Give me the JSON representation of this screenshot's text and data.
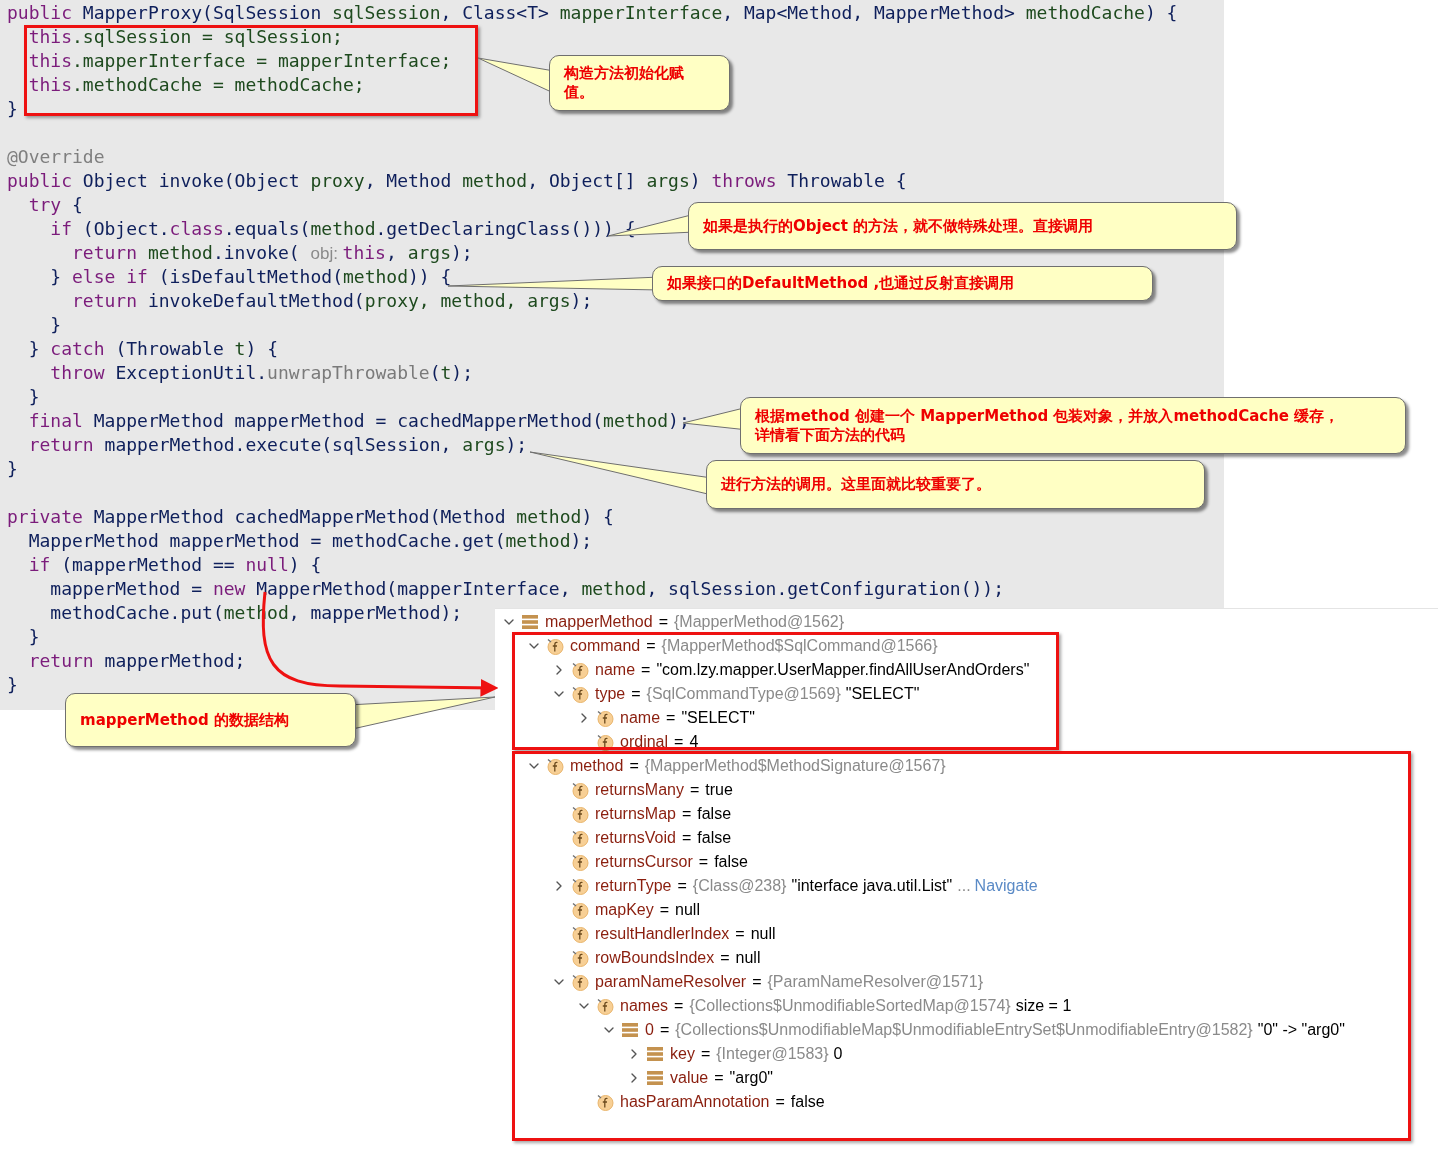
{
  "code": {
    "lines": [
      {
        "kind": "code",
        "segs": [
          {
            "kind": "keyword",
            "text": "public "
          },
          {
            "kind": "type",
            "text": "MapperProxy(SqlSession "
          },
          {
            "kind": "variable",
            "text": "sqlSession"
          },
          {
            "kind": "type",
            "text": ", Class<T> "
          },
          {
            "kind": "variable",
            "text": "mapperInterface"
          },
          {
            "kind": "type",
            "text": ", Map<Method, MapperMethod> "
          },
          {
            "kind": "variable",
            "text": "methodCache"
          },
          {
            "kind": "type",
            "text": ") {"
          }
        ]
      },
      {
        "kind": "code",
        "segs": [
          {
            "kind": "keyword",
            "text": "  this"
          },
          {
            "kind": "variable",
            "text": ".sqlSession = sqlSession;"
          }
        ]
      },
      {
        "kind": "code",
        "segs": [
          {
            "kind": "keyword",
            "text": "  this"
          },
          {
            "kind": "variable",
            "text": ".mapperInterface = mapperInterface;"
          }
        ]
      },
      {
        "kind": "code",
        "segs": [
          {
            "kind": "keyword",
            "text": "  this"
          },
          {
            "kind": "variable",
            "text": ".methodCache = methodCache;"
          }
        ]
      },
      {
        "kind": "code",
        "segs": [
          {
            "kind": "type",
            "text": "}"
          }
        ]
      },
      {
        "kind": "blank"
      },
      {
        "kind": "code",
        "segs": [
          {
            "kind": "annotation",
            "text": "@Override"
          }
        ]
      },
      {
        "kind": "code",
        "segs": [
          {
            "kind": "keyword",
            "text": "public "
          },
          {
            "kind": "type",
            "text": "Object invoke(Object "
          },
          {
            "kind": "variable",
            "text": "proxy"
          },
          {
            "kind": "type",
            "text": ", Method "
          },
          {
            "kind": "variable",
            "text": "method"
          },
          {
            "kind": "type",
            "text": ", Object[] "
          },
          {
            "kind": "variable",
            "text": "args"
          },
          {
            "kind": "type",
            "text": ") "
          },
          {
            "kind": "keyword",
            "text": "throws "
          },
          {
            "kind": "type",
            "text": "Throwable {"
          }
        ]
      },
      {
        "kind": "code",
        "segs": [
          {
            "kind": "keyword",
            "text": "  try "
          },
          {
            "kind": "type",
            "text": "{"
          }
        ]
      },
      {
        "kind": "code",
        "segs": [
          {
            "kind": "keyword",
            "text": "    if "
          },
          {
            "kind": "type",
            "text": "(Object."
          },
          {
            "kind": "keyword",
            "text": "class"
          },
          {
            "kind": "type",
            "text": ".equals("
          },
          {
            "kind": "variable",
            "text": "method"
          },
          {
            "kind": "type",
            "text": ".getDeclaringClass())) {"
          }
        ]
      },
      {
        "kind": "code",
        "segs": [
          {
            "kind": "keyword",
            "text": "      return "
          },
          {
            "kind": "variable",
            "text": "method"
          },
          {
            "kind": "type",
            "text": ".invoke( "
          },
          {
            "kind": "hint",
            "text": "obj: "
          },
          {
            "kind": "keyword",
            "text": "this"
          },
          {
            "kind": "type",
            "text": ", "
          },
          {
            "kind": "variable",
            "text": "args"
          },
          {
            "kind": "type",
            "text": ");"
          }
        ]
      },
      {
        "kind": "code",
        "segs": [
          {
            "kind": "type",
            "text": "    } "
          },
          {
            "kind": "keyword",
            "text": "else if "
          },
          {
            "kind": "type",
            "text": "(isDefaultMethod("
          },
          {
            "kind": "variable",
            "text": "method"
          },
          {
            "kind": "type",
            "text": ")) {"
          }
        ]
      },
      {
        "kind": "code",
        "segs": [
          {
            "kind": "keyword",
            "text": "      return "
          },
          {
            "kind": "type",
            "text": "invokeDefaultMethod("
          },
          {
            "kind": "variable",
            "text": "proxy, method, args"
          },
          {
            "kind": "type",
            "text": ");"
          }
        ]
      },
      {
        "kind": "code",
        "segs": [
          {
            "kind": "type",
            "text": "    }"
          }
        ]
      },
      {
        "kind": "code",
        "segs": [
          {
            "kind": "type",
            "text": "  } "
          },
          {
            "kind": "keyword",
            "text": "catch "
          },
          {
            "kind": "type",
            "text": "(Throwable "
          },
          {
            "kind": "variable",
            "text": "t"
          },
          {
            "kind": "type",
            "text": ") {"
          }
        ]
      },
      {
        "kind": "code",
        "segs": [
          {
            "kind": "keyword",
            "text": "    throw "
          },
          {
            "kind": "type",
            "text": "ExceptionUtil."
          },
          {
            "kind": "static",
            "text": "unwrapThrowable"
          },
          {
            "kind": "type",
            "text": "("
          },
          {
            "kind": "variable",
            "text": "t"
          },
          {
            "kind": "type",
            "text": ");"
          }
        ]
      },
      {
        "kind": "code",
        "segs": [
          {
            "kind": "type",
            "text": "  }"
          }
        ]
      },
      {
        "kind": "code",
        "segs": [
          {
            "kind": "keyword",
            "text": "  final "
          },
          {
            "kind": "type",
            "text": "MapperMethod mapperMethod = cachedMapperMethod("
          },
          {
            "kind": "variable",
            "text": "method"
          },
          {
            "kind": "type",
            "text": ");"
          }
        ]
      },
      {
        "kind": "code",
        "segs": [
          {
            "kind": "keyword",
            "text": "  return "
          },
          {
            "kind": "type",
            "text": "mapperMethod.execute(sqlSession, "
          },
          {
            "kind": "variable",
            "text": "args"
          },
          {
            "kind": "type",
            "text": ");"
          }
        ]
      },
      {
        "kind": "code",
        "segs": [
          {
            "kind": "type",
            "text": "}"
          }
        ]
      },
      {
        "kind": "blank"
      },
      {
        "kind": "code",
        "segs": [
          {
            "kind": "keyword",
            "text": "private "
          },
          {
            "kind": "type",
            "text": "MapperMethod cachedMapperMethod(Method "
          },
          {
            "kind": "variable",
            "text": "method"
          },
          {
            "kind": "type",
            "text": ") {"
          }
        ]
      },
      {
        "kind": "code",
        "segs": [
          {
            "kind": "type",
            "text": "  MapperMethod mapperMethod = methodCache.get("
          },
          {
            "kind": "variable",
            "text": "method"
          },
          {
            "kind": "type",
            "text": ");"
          }
        ]
      },
      {
        "kind": "code",
        "segs": [
          {
            "kind": "keyword",
            "text": "  if "
          },
          {
            "kind": "type",
            "text": "(mapperMethod == "
          },
          {
            "kind": "keyword",
            "text": "null"
          },
          {
            "kind": "type",
            "text": ") {"
          }
        ]
      },
      {
        "kind": "code",
        "segs": [
          {
            "kind": "type",
            "text": "    mapperMethod = "
          },
          {
            "kind": "keyword",
            "text": "new "
          },
          {
            "kind": "type",
            "text": "MapperMethod(mapperInterface, "
          },
          {
            "kind": "variable",
            "text": "method"
          },
          {
            "kind": "type",
            "text": ", sqlSession.getConfiguration());"
          }
        ]
      },
      {
        "kind": "code",
        "segs": [
          {
            "kind": "type",
            "text": "    methodCache.put("
          },
          {
            "kind": "variable",
            "text": "method"
          },
          {
            "kind": "type",
            "text": ", mapperMethod);"
          }
        ]
      },
      {
        "kind": "code",
        "segs": [
          {
            "kind": "type",
            "text": "  }"
          }
        ]
      },
      {
        "kind": "code",
        "segs": [
          {
            "kind": "keyword",
            "text": "  return "
          },
          {
            "kind": "type",
            "text": "mapperMethod;"
          }
        ]
      },
      {
        "kind": "code",
        "segs": [
          {
            "kind": "type",
            "text": "}"
          }
        ]
      }
    ]
  },
  "debugger": {
    "tree": [
      {
        "kind": "object",
        "name": "mapperMethod",
        "eq": "=",
        "ref": "{MapperMethod@1562}",
        "expanded": true,
        "children": [
          {
            "kind": "field",
            "name": "command",
            "eq": "=",
            "ref": "{MapperMethod$SqlCommand@1566}",
            "expanded": true,
            "children": [
              {
                "kind": "field",
                "name": "name",
                "eq": "=",
                "value": "\"com.lzy.mapper.UserMapper.findAllUserAndOrders\"",
                "expanded": false
              },
              {
                "kind": "field",
                "name": "type",
                "eq": "=",
                "ref": "{SqlCommandType@1569}",
                "value": "\"SELECT\"",
                "expanded": true,
                "children": [
                  {
                    "kind": "field",
                    "name": "name",
                    "eq": "=",
                    "value": "\"SELECT\"",
                    "expanded": false
                  },
                  {
                    "kind": "field",
                    "name": "ordinal",
                    "eq": "=",
                    "value": "4"
                  }
                ]
              }
            ]
          },
          {
            "kind": "field",
            "name": "method",
            "eq": "=",
            "ref": "{MapperMethod$MethodSignature@1567}",
            "expanded": true,
            "children": [
              {
                "kind": "field",
                "name": "returnsMany",
                "eq": "=",
                "value": "true"
              },
              {
                "kind": "field",
                "name": "returnsMap",
                "eq": "=",
                "value": "false"
              },
              {
                "kind": "field",
                "name": "returnsVoid",
                "eq": "=",
                "value": "false"
              },
              {
                "kind": "field",
                "name": "returnsCursor",
                "eq": "=",
                "value": "false"
              },
              {
                "kind": "field",
                "name": "returnType",
                "eq": "=",
                "ref": "{Class@238}",
                "value": "\"interface java.util.List\"",
                "ellipsis": "...",
                "link": "Navigate",
                "expanded": false
              },
              {
                "kind": "field",
                "name": "mapKey",
                "eq": "=",
                "value": "null"
              },
              {
                "kind": "field",
                "name": "resultHandlerIndex",
                "eq": "=",
                "value": "null"
              },
              {
                "kind": "field",
                "name": "rowBoundsIndex",
                "eq": "=",
                "value": "null"
              },
              {
                "kind": "field",
                "name": "paramNameResolver",
                "eq": "=",
                "ref": "{ParamNameResolver@1571}",
                "expanded": true,
                "children": [
                  {
                    "kind": "field",
                    "name": "names",
                    "eq": "=",
                    "ref": "{Collections$UnmodifiableSortedMap@1574}",
                    "value": "size = 1",
                    "expanded": true,
                    "children": [
                      {
                        "kind": "object",
                        "name": "0",
                        "eq": "=",
                        "ref": "{Collections$UnmodifiableMap$UnmodifiableEntrySet$UnmodifiableEntry@1582}",
                        "value": "\"0\" -> \"arg0\"",
                        "expanded": true,
                        "children": [
                          {
                            "kind": "object",
                            "name": "key",
                            "eq": "=",
                            "ref": "{Integer@1583}",
                            "value": "0",
                            "expanded": false
                          },
                          {
                            "kind": "object",
                            "name": "value",
                            "eq": "=",
                            "value": "\"arg0\"",
                            "expanded": false
                          }
                        ]
                      }
                    ]
                  },
                  {
                    "kind": "field",
                    "name": "hasParamAnnotation",
                    "eq": "=",
                    "value": "false"
                  }
                ]
              }
            ]
          }
        ]
      }
    ]
  },
  "callouts": [
    {
      "lines": [
        "构造方法初始化赋",
        "值。"
      ]
    },
    {
      "lines": [
        "如果是执行的Object 的方法，就不做特殊处理。直接调用"
      ]
    },
    {
      "lines": [
        "如果接口的DefaultMethod ,也通过反射直接调用"
      ]
    },
    {
      "lines": [
        "根据method 创建一个 MapperMethod 包装对象，并放入methodCache 缓存，",
        "详情看下面方法的代码"
      ]
    },
    {
      "lines": [
        "进行方法的调用。这里面就比较重要了。"
      ]
    },
    {
      "lines": [
        "mapperMethod 的数据结构"
      ]
    }
  ]
}
